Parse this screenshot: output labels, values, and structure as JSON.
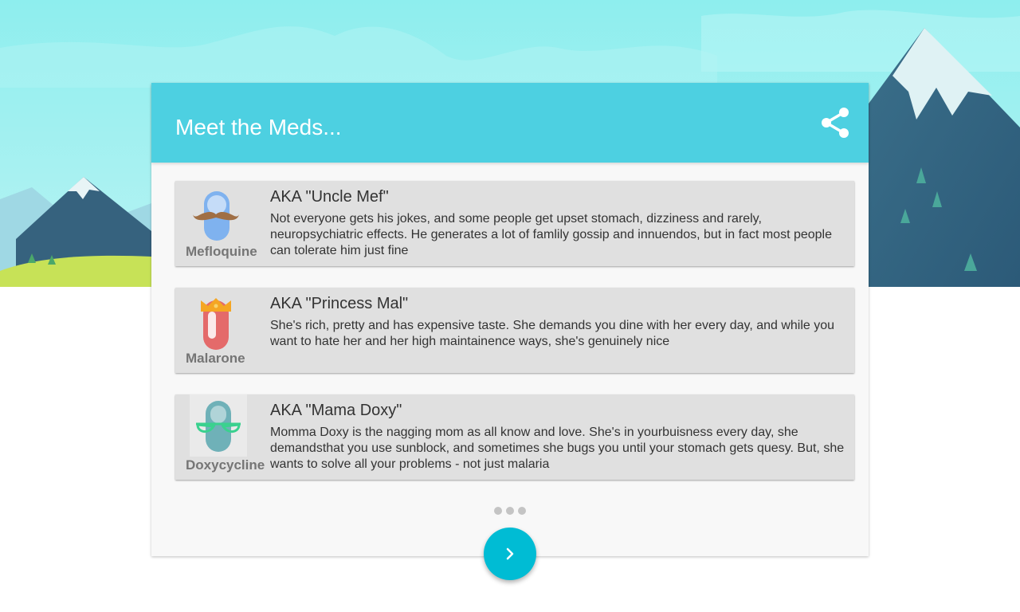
{
  "header": {
    "title": "Meet the Meds..."
  },
  "meds": [
    {
      "name": "Mefloquine",
      "aka": "AKA \"Uncle Mef\"",
      "description": "Not everyone gets his jokes, and some people get upset stomach, dizziness and rarely, neuropsychiatric effects. He generates a lot of famlily gossip and innuendos, but in fact most people can tolerate him just fine",
      "icon": "pill-mustache-icon"
    },
    {
      "name": "Malarone",
      "aka": "AKA \"Princess Mal\"",
      "description": "She's rich, pretty and has expensive taste. She demands you dine with her every day, and while you want to hate her and her high maintainence ways, she's genuinely nice",
      "icon": "pill-crown-icon"
    },
    {
      "name": "Doxycycline",
      "aka": "AKA \"Mama Doxy\"",
      "description": "Momma Doxy is the nagging mom as all know and love. She's in yourbuisness every day, she demandsthat you use sunblock, and sometimes she bugs you until your stomach gets quesy. But, she wants to solve all your problems - not just malaria",
      "icon": "pill-glasses-icon"
    }
  ],
  "pager": {
    "page_count": 3
  },
  "colors": {
    "header": "#4dd0e1",
    "fab": "#00bcd4",
    "card": "#f8f8f8",
    "item": "#e0e0e0"
  }
}
